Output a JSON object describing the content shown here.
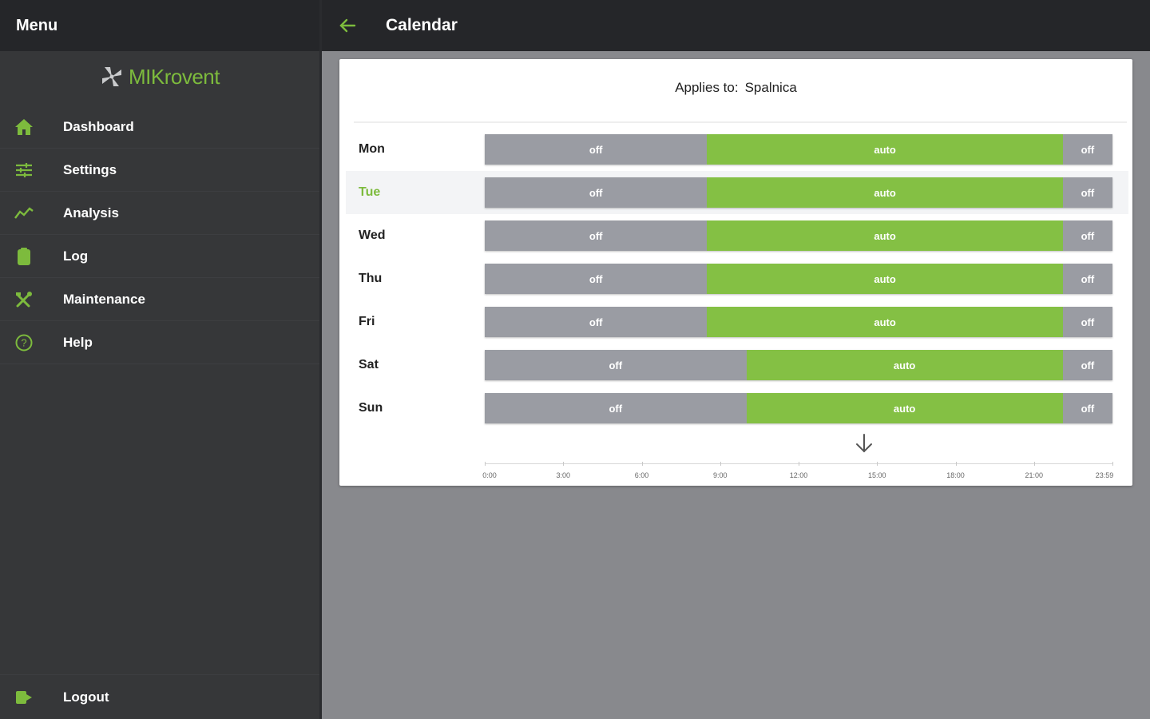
{
  "sidebar": {
    "header": "Menu",
    "logo": "MIKrovent",
    "items": [
      {
        "label": "Dashboard",
        "icon": "home-icon"
      },
      {
        "label": "Settings",
        "icon": "sliders-icon"
      },
      {
        "label": "Analysis",
        "icon": "trend-icon"
      },
      {
        "label": "Log",
        "icon": "clipboard-icon"
      },
      {
        "label": "Maintenance",
        "icon": "tools-icon"
      },
      {
        "label": "Help",
        "icon": "help-icon"
      }
    ],
    "logout": "Logout"
  },
  "topbar": {
    "title": "Calendar"
  },
  "calendar": {
    "applies_label": "Applies to:",
    "applies_value": "Spalnica",
    "selected_day": "Tue",
    "colors": {
      "off": "#9a9ca3",
      "auto": "#84c044",
      "accent": "#7dbb3d"
    },
    "days": [
      {
        "name": "Mon",
        "segments": [
          {
            "mode": "off",
            "start": 0,
            "end": 8.5
          },
          {
            "mode": "auto",
            "start": 8.5,
            "end": 22.1
          },
          {
            "mode": "off",
            "start": 22.1,
            "end": 24
          }
        ]
      },
      {
        "name": "Tue",
        "segments": [
          {
            "mode": "off",
            "start": 0,
            "end": 8.5
          },
          {
            "mode": "auto",
            "start": 8.5,
            "end": 22.1
          },
          {
            "mode": "off",
            "start": 22.1,
            "end": 24
          }
        ]
      },
      {
        "name": "Wed",
        "segments": [
          {
            "mode": "off",
            "start": 0,
            "end": 8.5
          },
          {
            "mode": "auto",
            "start": 8.5,
            "end": 22.1
          },
          {
            "mode": "off",
            "start": 22.1,
            "end": 24
          }
        ]
      },
      {
        "name": "Thu",
        "segments": [
          {
            "mode": "off",
            "start": 0,
            "end": 8.5
          },
          {
            "mode": "auto",
            "start": 8.5,
            "end": 22.1
          },
          {
            "mode": "off",
            "start": 22.1,
            "end": 24
          }
        ]
      },
      {
        "name": "Fri",
        "segments": [
          {
            "mode": "off",
            "start": 0,
            "end": 8.5
          },
          {
            "mode": "auto",
            "start": 8.5,
            "end": 22.1
          },
          {
            "mode": "off",
            "start": 22.1,
            "end": 24
          }
        ]
      },
      {
        "name": "Sat",
        "segments": [
          {
            "mode": "off",
            "start": 0,
            "end": 10
          },
          {
            "mode": "auto",
            "start": 10,
            "end": 22.1
          },
          {
            "mode": "off",
            "start": 22.1,
            "end": 24
          }
        ]
      },
      {
        "name": "Sun",
        "segments": [
          {
            "mode": "off",
            "start": 0,
            "end": 10
          },
          {
            "mode": "auto",
            "start": 10,
            "end": 22.1
          },
          {
            "mode": "off",
            "start": 22.1,
            "end": 24
          }
        ]
      }
    ],
    "axis_ticks": [
      {
        "label": "0:00",
        "hour": 0
      },
      {
        "label": "3:00",
        "hour": 3
      },
      {
        "label": "6:00",
        "hour": 6
      },
      {
        "label": "9:00",
        "hour": 9
      },
      {
        "label": "12:00",
        "hour": 12
      },
      {
        "label": "15:00",
        "hour": 15
      },
      {
        "label": "18:00",
        "hour": 18
      },
      {
        "label": "21:00",
        "hour": 21
      },
      {
        "label": "23:59",
        "hour": 24
      }
    ]
  }
}
